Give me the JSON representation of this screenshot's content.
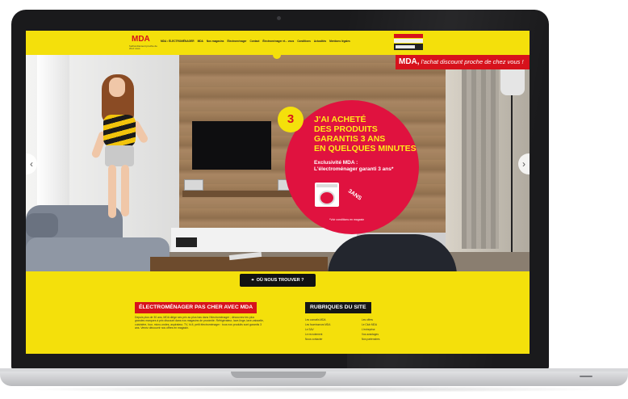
{
  "header": {
    "logo": "MDA",
    "logo_tagline": "l'achat discount proche de chez vous",
    "nav": [
      "MDA • ÉLECTROMÉNAGER",
      "MDA",
      "Nos magasins",
      "Électroménager",
      "Contact",
      "Électroménager et... vous",
      "Conditions",
      "Actualités",
      "Mentions légales"
    ]
  },
  "slogan": {
    "brand": "MDA,",
    "text": " l'achat discount proche de chez vous !"
  },
  "hero": {
    "prev_arrow": "‹",
    "next_arrow": "›",
    "slide_count": 4,
    "active_slide": 1
  },
  "promo": {
    "number": "3",
    "title": "J'AI ACHETÉ\nDES PRODUITS\nGARANTIS 3 ANS\nEN QUELQUES MINUTES",
    "subtitle": "Exclusivité MDA :\nL'électroménager garanti 3 ans*",
    "badge": "3ANS",
    "note": "*Voir conditions en magasin"
  },
  "find_store": {
    "icon": "map-pin-icon",
    "label": "OÙ NOUS TROUVER ?"
  },
  "section_a": {
    "title": "ÉLECTROMÉNAGER PAS CHER    AVEC MDA",
    "text": "Depuis plus de 30 ans, MDA dirige ses prix au plus bas dans l'électroménager ; découvrez les plus grandes marques à prix discount dans nos magasins de proximité. Réfrigérateur, lave-linge, lave-vaisselle, cuisinière, four, micro-ondes, aspirateur, TV, hi-fi, petit électroménager : tous nos produits sont garantis 3 ans. Venez découvrir nos offres en magasin."
  },
  "section_b": {
    "title": "RUBRIQUES DU SITE",
    "links": [
      "Les conseils MDA",
      "Les offres",
      "Les fournisseurs MDA",
      "Le Club MDA",
      "Le SAV",
      "L'entreprise",
      "Le recrutement",
      "Vos avantages",
      "Nous contacter",
      "Nos partenaires"
    ]
  }
}
